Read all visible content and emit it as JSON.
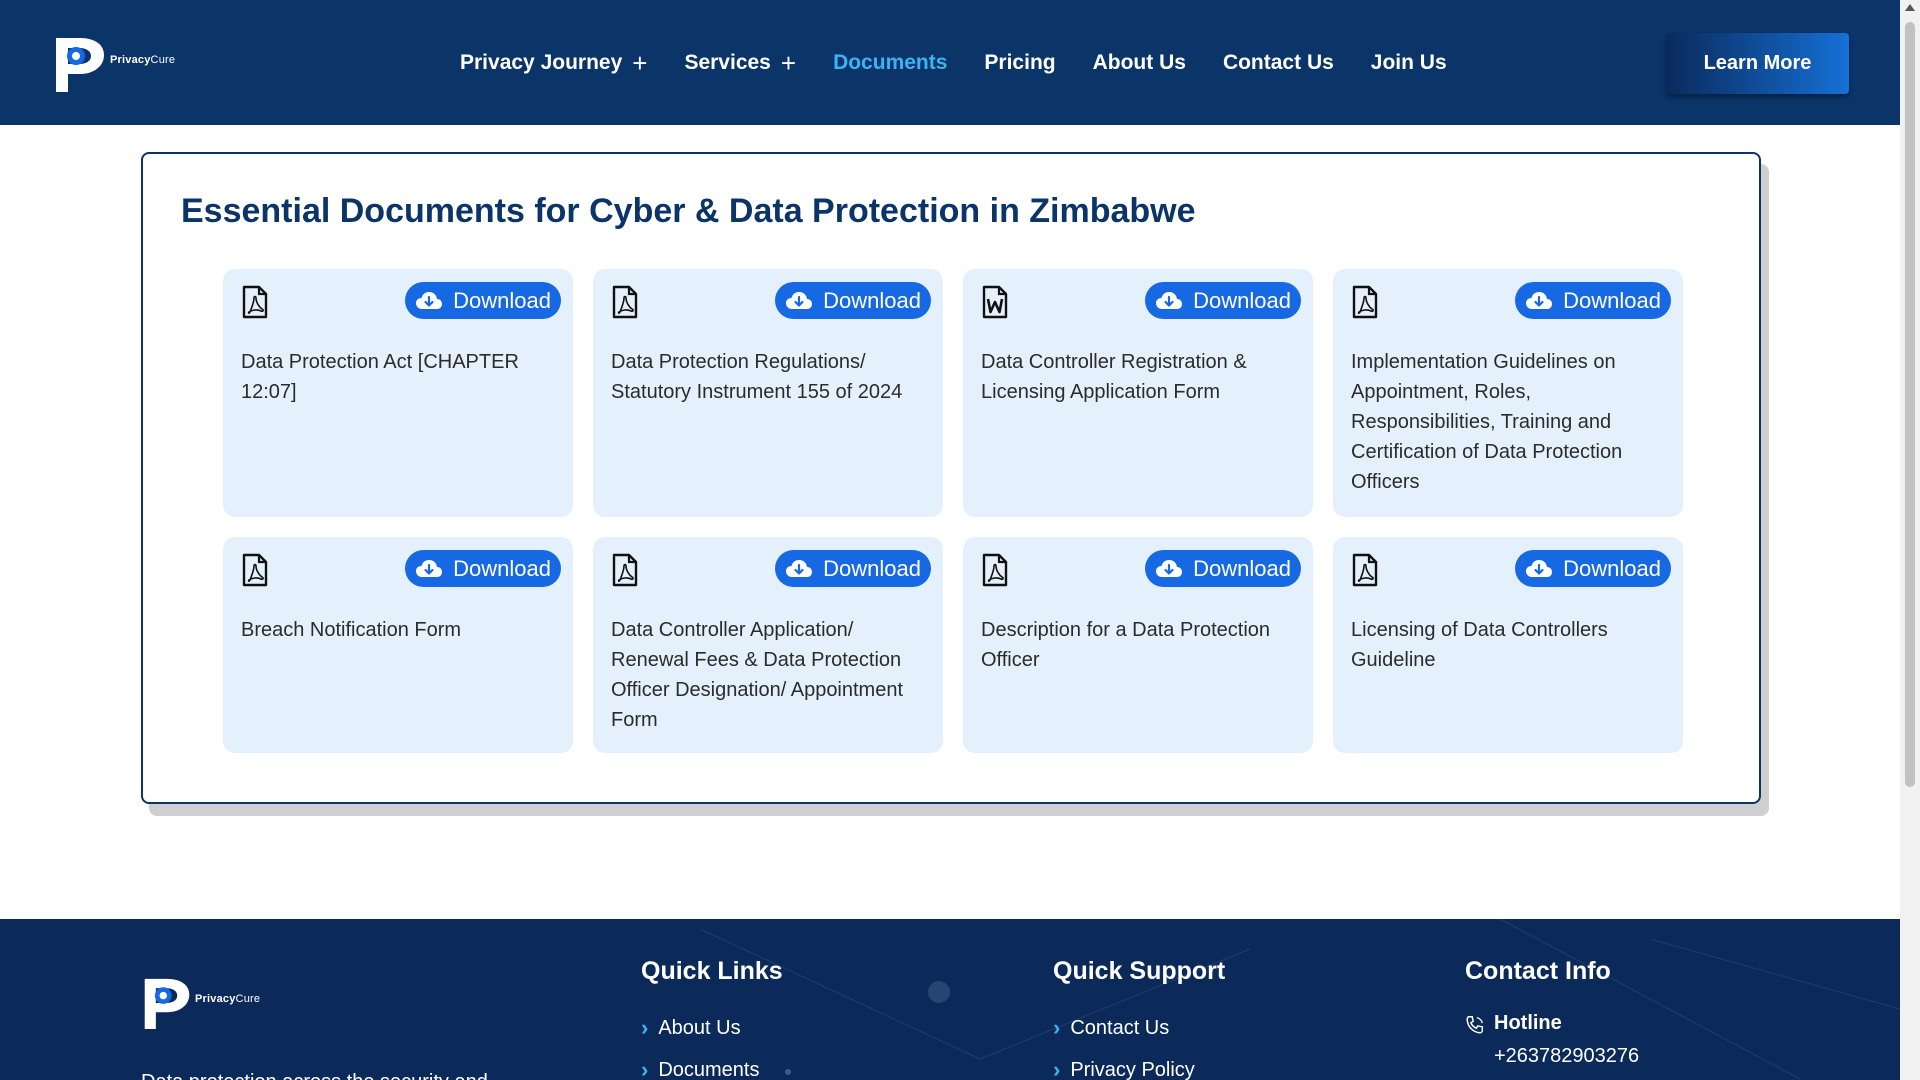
{
  "header": {
    "logo_text_bold": "Privacy",
    "logo_text_light": "Cure",
    "nav": [
      {
        "label": "Privacy Journey",
        "plus": "+"
      },
      {
        "label": "Services",
        "plus": "+"
      },
      {
        "label": "Documents",
        "plus": ""
      },
      {
        "label": "Pricing",
        "plus": ""
      },
      {
        "label": "About Us",
        "plus": ""
      },
      {
        "label": "Contact Us",
        "plus": ""
      },
      {
        "label": "Join Us",
        "plus": ""
      }
    ],
    "active_nav": "Documents",
    "learn_more": "Learn More"
  },
  "documents": {
    "title": "Essential Documents for Cyber & Data Protection in Zimbabwe",
    "download_label": "Download",
    "cards": [
      {
        "icon": "pdf-file-icon",
        "text": "Data Protection Act [CHAPTER 12:07]"
      },
      {
        "icon": "pdf-file-icon",
        "text": "Data Protection Regulations/ Statutory Instrument 155 of 2024"
      },
      {
        "icon": "word-file-icon",
        "text": "Data Controller Registration & Licensing Application Form"
      },
      {
        "icon": "pdf-file-icon",
        "text": "Implementation Guidelines on Appointment, Roles, Responsibilities, Training and Certification of Data Protection Officers"
      },
      {
        "icon": "pdf-file-icon",
        "text": "Breach Notification Form"
      },
      {
        "icon": "pdf-file-icon",
        "text": "Data Controller Application/ Renewal Fees & Data Protection Officer Designation/ Appointment Form"
      },
      {
        "icon": "pdf-file-icon",
        "text": "Description for a Data Protection Officer"
      },
      {
        "icon": "pdf-file-icon",
        "text": "Licensing of Data Controllers Guideline"
      }
    ]
  },
  "footer": {
    "quick_links_title": "Quick Links",
    "quick_links": [
      "About Us",
      "Documents"
    ],
    "quick_support_title": "Quick Support",
    "quick_support": [
      "Contact Us",
      "Privacy Policy"
    ],
    "contact_title": "Contact Info",
    "hotline_label": "Hotline",
    "hotline_number": "+263782903276",
    "description_partial": "Data protection across the security and"
  },
  "colors": {
    "header_bg": "#0b3468",
    "accent": "#3ab4f2",
    "download_btn": "#1769e3",
    "card_bg": "#e4f1fc",
    "footer_bg": "#0b2a5a"
  }
}
